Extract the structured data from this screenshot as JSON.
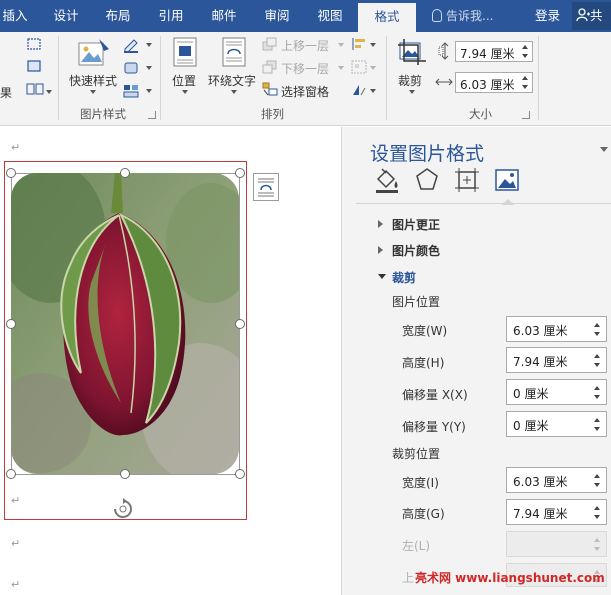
{
  "tabs": {
    "insert": "插入",
    "design": "设计",
    "layout": "布局",
    "references": "引用",
    "mailings": "邮件",
    "review": "审阅",
    "view": "视图",
    "format": "格式"
  },
  "tell_me": "告诉我...",
  "login": "登录",
  "share": "共",
  "ribbon": {
    "partial_label": "果",
    "quick_styles": "快速样式",
    "picture_styles_group": "图片样式",
    "position": "位置",
    "wrap_text": "环绕文字",
    "bring_forward": "上移一层",
    "send_backward": "下移一层",
    "selection_pane": "选择窗格",
    "arrange_group": "排列",
    "crop": "裁剪",
    "height": "7.94 厘米",
    "width": "6.03 厘米",
    "size_group": "大小"
  },
  "pane": {
    "title": "设置图片格式",
    "picture_corrections": "图片更正",
    "picture_color": "图片颜色",
    "crop": "裁剪",
    "picture_position": "图片位置",
    "pp_width_label": "宽度(W)",
    "pp_width": "6.03 厘米",
    "pp_height_label": "高度(H)",
    "pp_height": "7.94 厘米",
    "offset_x_label": "偏移量 X(X)",
    "offset_x": "0 厘米",
    "offset_y_label": "偏移量 Y(Y)",
    "offset_y": "0 厘米",
    "crop_position": "裁剪位置",
    "cp_width_label": "宽度(I)",
    "cp_width": "6.03 厘米",
    "cp_height_label": "高度(G)",
    "cp_height": "7.94 厘米",
    "left_label": "左(L)",
    "top_label": "上"
  },
  "paragraph_mark": "↵",
  "watermark": "亮术网 www.liangshunet.com",
  "colors": {
    "accent": "#2b579a",
    "selection_border": "#c0393b"
  }
}
